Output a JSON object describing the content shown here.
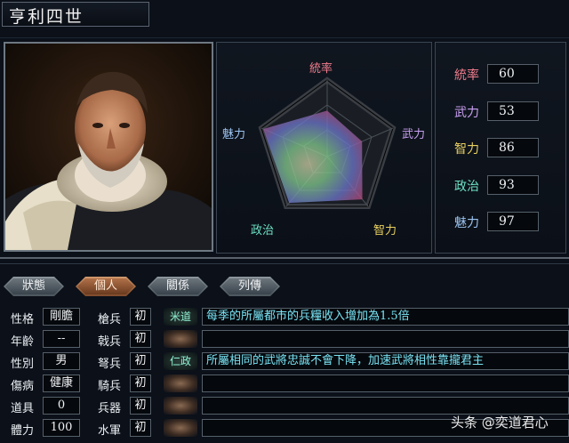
{
  "character": {
    "name": "亨利四世"
  },
  "radar": {
    "labels": {
      "leadership": "統率",
      "war": "武力",
      "intelligence": "智力",
      "politics": "政治",
      "charm": "魅力"
    },
    "label_colors": {
      "leadership": "#f07c8c",
      "war": "#c8a0f0",
      "intelligence": "#e8d060",
      "politics": "#6ce0c4",
      "charm": "#9cc4f0"
    }
  },
  "stats": [
    {
      "label": "統率",
      "value": "60",
      "color": "#f07c8c"
    },
    {
      "label": "武力",
      "value": "53",
      "color": "#c8a0f0"
    },
    {
      "label": "智力",
      "value": "86",
      "color": "#e8d060"
    },
    {
      "label": "政治",
      "value": "93",
      "color": "#6ce0c4"
    },
    {
      "label": "魅力",
      "value": "97",
      "color": "#9cc4f0"
    }
  ],
  "tabs": [
    "狀態",
    "個人",
    "關係",
    "列傳"
  ],
  "active_tab": "個人",
  "personal": [
    {
      "label": "性格",
      "value": "剛膽"
    },
    {
      "label": "年齡",
      "value": "--"
    },
    {
      "label": "性別",
      "value": "男"
    },
    {
      "label": "傷病",
      "value": "健康"
    },
    {
      "label": "道具",
      "value": "0"
    },
    {
      "label": "體力",
      "value": "100"
    }
  ],
  "troops": [
    {
      "label": "槍兵",
      "value": "初"
    },
    {
      "label": "戟兵",
      "value": "初"
    },
    {
      "label": "弩兵",
      "value": "初"
    },
    {
      "label": "騎兵",
      "value": "初"
    },
    {
      "label": "兵器",
      "value": "初"
    },
    {
      "label": "水軍",
      "value": "初"
    }
  ],
  "skills": [
    {
      "name": "米道",
      "desc": "每季的所屬都市的兵糧收入增加為1.5倍"
    },
    {
      "name": "",
      "desc": ""
    },
    {
      "name": "仁政",
      "desc": "所屬相同的武將忠誠不會下降，加速武將相性靠攏君主"
    },
    {
      "name": "",
      "desc": ""
    },
    {
      "name": "",
      "desc": ""
    },
    {
      "name": "",
      "desc": ""
    }
  ],
  "watermark": "头条 @奕道君心"
}
